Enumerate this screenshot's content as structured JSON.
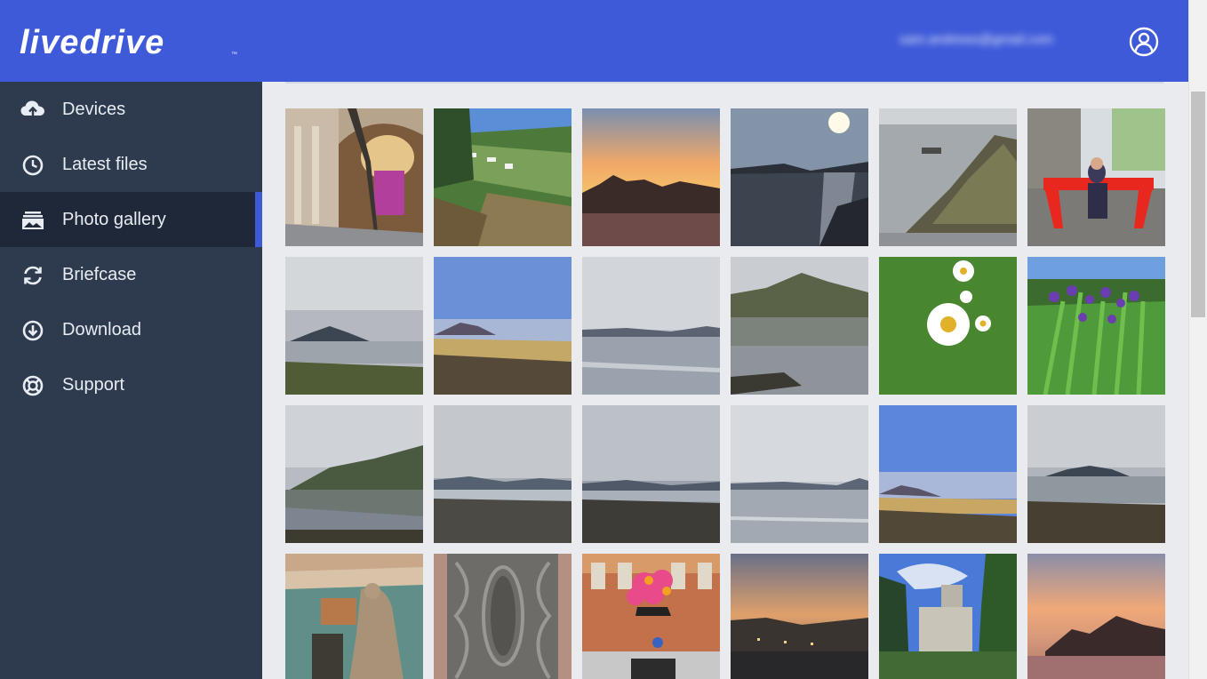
{
  "header": {
    "logo_text": "livedrive",
    "logo_tm": "™",
    "user_email": "sam.andrews@gmail.com",
    "account_icon": "user-circle-icon",
    "brand_color": "#3e5ad9"
  },
  "sidebar": {
    "items": [
      {
        "label": "Devices",
        "icon": "cloud-upload-icon",
        "active": false
      },
      {
        "label": "Latest files",
        "icon": "clock-icon",
        "active": false
      },
      {
        "label": "Photo gallery",
        "icon": "photo-stack-icon",
        "active": true
      },
      {
        "label": "Briefcase",
        "icon": "sync-icon",
        "active": false
      },
      {
        "label": "Download",
        "icon": "download-circle-icon",
        "active": false
      },
      {
        "label": "Support",
        "icon": "lifebuoy-icon",
        "active": false
      }
    ]
  },
  "gallery": {
    "photos": [
      "cathedral-interior",
      "coastal-village",
      "sunset-rocks",
      "moonlit-bay",
      "rocky-shore-boat",
      "red-bench",
      "island-cloudy",
      "beach-mountain",
      "calm-loch",
      "mountain-reflection",
      "daisies",
      "purple-irises",
      "hill-reflection",
      "shore-overcast",
      "stony-beach",
      "loch-morning",
      "blue-sky-beach",
      "distant-island",
      "museum-statue",
      "carved-pillar",
      "flower-sculpture",
      "harbour-dusk",
      "castle-tree",
      "sunset-headland"
    ]
  }
}
